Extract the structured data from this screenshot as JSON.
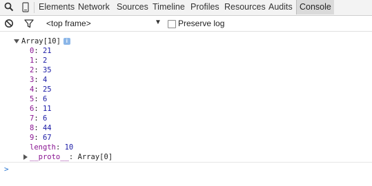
{
  "tabs": {
    "items": [
      "Elements",
      "Network",
      "Sources",
      "Timeline",
      "Profiles",
      "Resources",
      "Audits",
      "Console"
    ],
    "active": "Console"
  },
  "toolbar": {
    "context": "<top frame>",
    "preserve_log_label": "Preserve log",
    "preserve_log_checked": false
  },
  "console": {
    "array_label": "Array[10]",
    "info_badge": "i",
    "entries": [
      {
        "key": "0",
        "value": "21"
      },
      {
        "key": "1",
        "value": "2"
      },
      {
        "key": "2",
        "value": "35"
      },
      {
        "key": "3",
        "value": "4"
      },
      {
        "key": "4",
        "value": "25"
      },
      {
        "key": "5",
        "value": "6"
      },
      {
        "key": "6",
        "value": "11"
      },
      {
        "key": "7",
        "value": "6"
      },
      {
        "key": "8",
        "value": "44"
      },
      {
        "key": "9",
        "value": "67"
      }
    ],
    "length_key": "length",
    "length_value": "10",
    "proto_key": "__proto__",
    "proto_value": "Array[0]",
    "prompt": ">"
  },
  "icons": {
    "search": "search-icon",
    "device": "device-mode-icon",
    "clear": "clear-console-icon",
    "filter": "filter-icon",
    "dropdown": "dropdown-arrow-icon",
    "expand": "expand-triangle-icon",
    "collapse": "collapse-triangle-icon"
  }
}
